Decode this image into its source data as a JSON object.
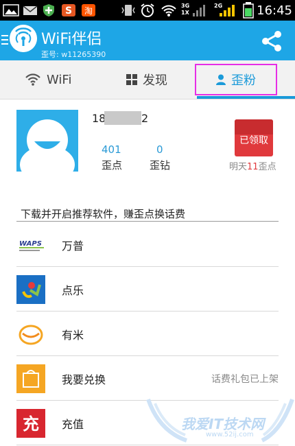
{
  "status_bar": {
    "time": "16:45",
    "net_3g": "3G",
    "net_1x": "1X",
    "net_2g": "2G"
  },
  "app_bar": {
    "title": "WiFi伴侣",
    "subtitle": "歪号: w11265390"
  },
  "tabs": [
    {
      "label": "WiFi",
      "icon": "wifi-icon"
    },
    {
      "label": "发现",
      "icon": "grid-icon"
    },
    {
      "label": "歪粉",
      "icon": "person-icon",
      "active": true
    }
  ],
  "profile": {
    "uid_prefix": "18",
    "uid_suffix": "2",
    "points_value": "401",
    "points_label": "歪点",
    "diamonds_value": "0",
    "diamonds_label": "歪钻",
    "redpack_label": "已领取",
    "tomorrow_prefix": "明天",
    "tomorrow_num": "11",
    "tomorrow_suffix": "歪点"
  },
  "promo": {
    "header": "下载并开启推荐软件，赚歪点换话费",
    "items": [
      {
        "label": "万普",
        "right": "",
        "icon": "wanpu-logo-icon"
      },
      {
        "label": "点乐",
        "right": "",
        "icon": "dianle-logo-icon"
      },
      {
        "label": "有米",
        "right": "",
        "icon": "youmi-logo-icon"
      },
      {
        "label": "我要兑换",
        "right": "话费礼包已上架",
        "icon": "exchange-bag-icon"
      },
      {
        "label": "充值",
        "right": "",
        "icon": "recharge-icon"
      }
    ],
    "wanpu_logo_text": "WAPS",
    "recharge_char": "充"
  },
  "watermark": {
    "text": "我爱IT技术网",
    "url": "www.52ij.com"
  },
  "colors": {
    "accent": "#1ea6e6",
    "tab_active": "#1a9ad9",
    "highlight_box": "#e62ee6",
    "red": "#e0393c"
  }
}
